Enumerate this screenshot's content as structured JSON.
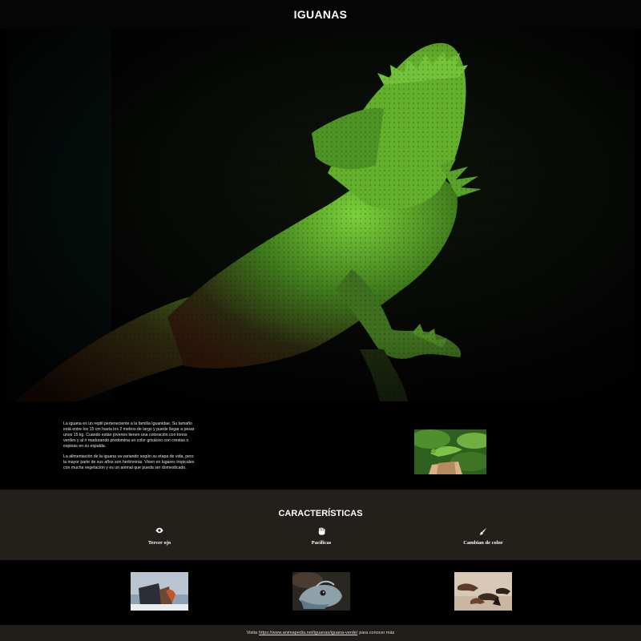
{
  "header": {
    "title": "IGUANAS"
  },
  "hero": {
    "image": "iguana-hero-photo"
  },
  "intro": {
    "paragraph_1": "La iguana es un reptil perteneciente a la familia Iguanidae. Su tamaño está entre los 15 cm hasta los 2 metros de largo y puede llegar a pesar unos 15 kg. Cuando están jóvenes tienen una coloración con tonos verdes y al ir madurando predomina un color grisáceo con crestas o espinas en su espalda.",
    "paragraph_2": "La alimentación de la iguana va variando según su etapa de vida, pero la mayor parte de sus años son herbívoras. Viven en lugares tropicales con mucha vegetación y es un animal que pueda ser domesticado.",
    "image": "iguana-on-branch-thumbnail"
  },
  "features": {
    "title": "CARACTERÍSTICAS",
    "items": [
      {
        "icon": "eye-icon",
        "label": "Tercer ojo"
      },
      {
        "icon": "hand-icon",
        "label": "Pacíficas"
      },
      {
        "icon": "brush-icon",
        "label": "Cambian de color"
      }
    ]
  },
  "gallery": {
    "images": [
      "iguana-on-rock-photo",
      "iguana-head-closeup-photo",
      "iguanas-group-on-beach-photo"
    ]
  },
  "footer": {
    "prefix": "Visita",
    "link": "https://www.animapedia.net/iguanas/iguana-verde/",
    "suffix": "para conocer más"
  },
  "colors": {
    "background": "#000000",
    "features_band": "#231f1a",
    "footer_band": "#211d19",
    "iguana_green": "#5fa82a"
  }
}
